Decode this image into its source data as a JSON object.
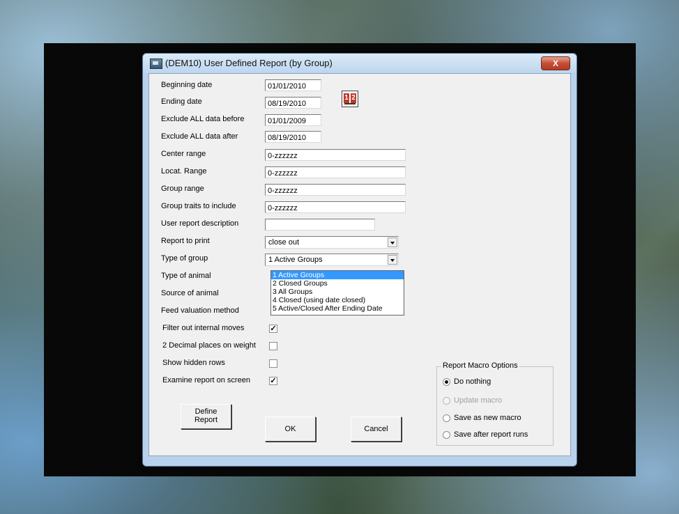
{
  "window": {
    "title": "(DEM10)  User Defined Report (by Group)",
    "close_glyph": "X"
  },
  "form": {
    "beginning_date_label": "Beginning date",
    "beginning_date_value": "01/01/2010",
    "ending_date_label": "Ending date",
    "ending_date_value": "08/19/2010",
    "exclude_before_label": "Exclude ALL data before",
    "exclude_before_value": "01/01/2009",
    "exclude_after_label": "Exclude ALL data after",
    "exclude_after_value": "08/19/2010",
    "center_range_label": "Center range",
    "center_range_value": "0-zzzzzz",
    "locat_range_label": "Locat. Range",
    "locat_range_value": "0-zzzzzz",
    "group_range_label": "Group range",
    "group_range_value": "0-zzzzzz",
    "group_traits_label": "Group traits to include",
    "group_traits_value": "0-zzzzzz",
    "user_report_desc_label": "User report description",
    "user_report_desc_value": "",
    "report_to_print_label": "Report to print",
    "report_to_print_value": "close out",
    "type_of_group_label": "Type of group",
    "type_of_group_value": "1  Active Groups",
    "type_of_animal_label": "Type of animal",
    "source_of_animal_label": "Source of animal",
    "feed_valuation_label": "Feed valuation method"
  },
  "type_of_group_options": [
    "1  Active Groups",
    "2  Closed Groups",
    "3  All Groups",
    "4  Closed (using date closed)",
    "5  Active/Closed After Ending Date"
  ],
  "checkboxes": {
    "filter_internal_moves_label": "Filter out internal moves",
    "filter_internal_moves_mark": "✓",
    "two_decimal_label": "2 Decimal places on weight",
    "two_decimal_mark": "",
    "show_hidden_rows_label": "Show hidden rows",
    "show_hidden_rows_mark": "",
    "examine_on_screen_label": "Examine report on screen",
    "examine_on_screen_mark": "✓"
  },
  "buttons": {
    "define_report_line1": "Define",
    "define_report_line2": "Report",
    "ok": "OK",
    "cancel": "Cancel"
  },
  "macro_options": {
    "title": "Report Macro Options",
    "do_nothing": "Do nothing",
    "update_macro": "Update macro",
    "save_as_new": "Save as new macro",
    "save_after_runs": "Save after report runs"
  }
}
